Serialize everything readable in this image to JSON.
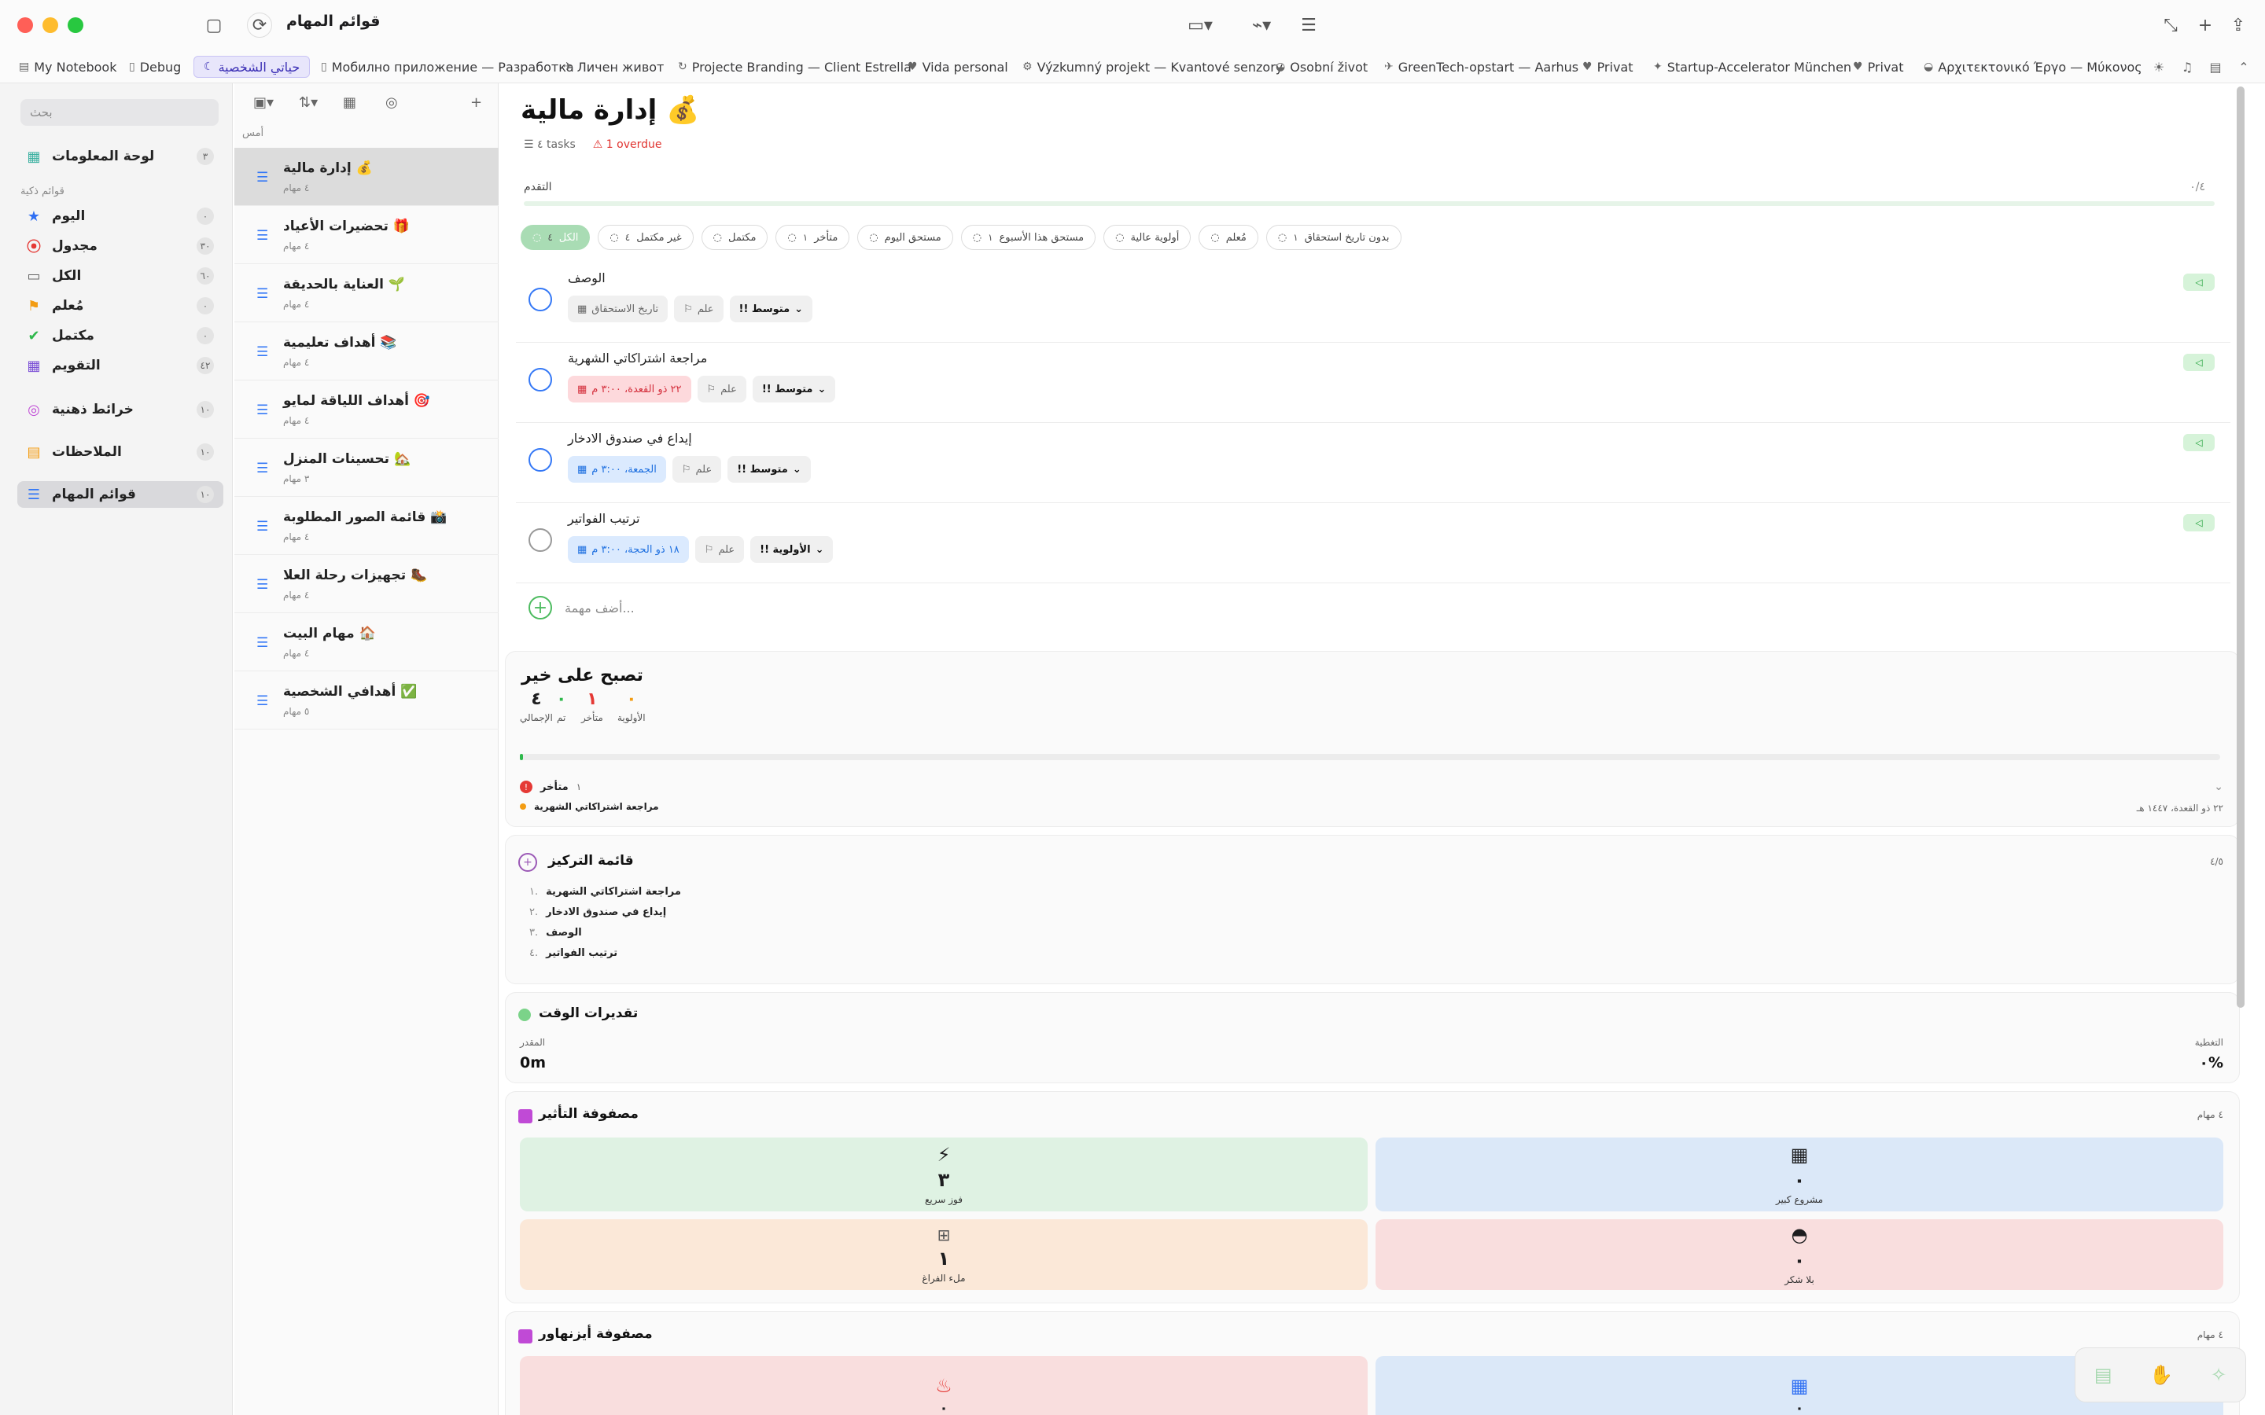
{
  "window": {
    "title": "قوائم المهام"
  },
  "tabs": [
    {
      "label": "My Notebook"
    },
    {
      "label": "Debug"
    },
    {
      "label": "حياتي الشخصية",
      "active": true
    },
    {
      "label": "Мобилно приложение — Разработка"
    },
    {
      "label": "Личен живот"
    },
    {
      "label": "Projecte Branding — Client Estrella"
    },
    {
      "label": "Vida personal"
    },
    {
      "label": "Výzkumný projekt — Kvantové senzory"
    },
    {
      "label": "Osobní život"
    },
    {
      "label": "GreenTech-opstart — Aarhus"
    },
    {
      "label": "Privat"
    },
    {
      "label": "Startup-Accelerator München"
    },
    {
      "label": "Privat"
    },
    {
      "label": "Αρχιτεκτονικό Έργο — Μύκονος"
    }
  ],
  "sidebar": {
    "search_placeholder": "بحث",
    "dashboard": {
      "label": "لوحة المعلومات",
      "count": "٣"
    },
    "smart_lists_title": "قوائم ذكية",
    "items": [
      {
        "label": "اليوم",
        "count": "٠",
        "icon": "star-icon",
        "color": "#2f6ff3"
      },
      {
        "label": "مجدول",
        "count": "٣٠",
        "icon": "calendar-circle-icon",
        "color": "#e53935"
      },
      {
        "label": "الكل",
        "count": "٦٠",
        "icon": "tray-icon",
        "color": "#666666"
      },
      {
        "label": "مُعلم",
        "count": "٠",
        "icon": "flag-icon",
        "color": "#f39c12"
      },
      {
        "label": "مكتمل",
        "count": "٠",
        "icon": "check-circle-icon",
        "color": "#2eb84b"
      },
      {
        "label": "التقويم",
        "count": "٤٢",
        "icon": "calendar-icon",
        "color": "#7b4fd6"
      }
    ],
    "mindmaps": {
      "label": "خرائط ذهنية",
      "count": "١٠"
    },
    "notes": {
      "label": "الملاحظات",
      "count": "١٠"
    },
    "tasklists": {
      "label": "قوائم المهام",
      "count": "١٠"
    }
  },
  "list_pane": {
    "date_label": "أمس",
    "items": [
      {
        "title": "إدارة مالية 💰",
        "sub": "٤ مهام"
      },
      {
        "title": "تحضيرات الأعياد 🎁",
        "sub": "٤ مهام"
      },
      {
        "title": "العناية بالحديقة 🌱",
        "sub": "٤ مهام"
      },
      {
        "title": "أهداف تعليمية 📚",
        "sub": "٤ مهام"
      },
      {
        "title": "أهداف اللياقة لمايو 🎯",
        "sub": "٤ مهام"
      },
      {
        "title": "تحسينات المنزل 🏡",
        "sub": "٣ مهام"
      },
      {
        "title": "قائمة الصور المطلوبة 📸",
        "sub": "٤ مهام"
      },
      {
        "title": "تجهيزات رحلة العلا 🥾",
        "sub": "٤ مهام"
      },
      {
        "title": "مهام البيت 🏠",
        "sub": "٤ مهام"
      },
      {
        "title": "أهدافي الشخصية ✅",
        "sub": "٥ مهام"
      }
    ]
  },
  "main": {
    "title": "إدارة مالية 💰",
    "tasks_count": "٤ tasks",
    "overdue": "1 overdue",
    "progress_label": "التقدم",
    "progress_count": "٠/٤",
    "progress_value": 0,
    "filters": [
      {
        "label": "الكل",
        "count": "٤",
        "on": true
      },
      {
        "label": "غير مكتمل",
        "count": "٤"
      },
      {
        "label": "مكتمل",
        "count": ""
      },
      {
        "label": "متأخر",
        "count": "١"
      },
      {
        "label": "مستحق اليوم",
        "count": ""
      },
      {
        "label": "مستحق هذا الأسبوع",
        "count": "١"
      },
      {
        "label": "أولوية عالية",
        "count": ""
      },
      {
        "label": "مُعلم",
        "count": ""
      },
      {
        "label": "بدون تاريخ استحقاق",
        "count": "١"
      }
    ],
    "tasks": [
      {
        "title": "الوصف",
        "date": "تاريخ الاستحقاق",
        "date_style": "plain",
        "flag": "علم",
        "priority": "!! متوسط",
        "tag": "◁"
      },
      {
        "title": "مراجعة اشتراكاتي الشهرية",
        "date": "٢٢ ذو القعدة، ٣:٠٠ م",
        "date_style": "red",
        "flag": "علم",
        "priority": "!! متوسط",
        "tag": "◁"
      },
      {
        "title": "إيداع في صندوق الادخار",
        "date": "الجمعة، ٣:٠٠ م",
        "date_style": "blue",
        "flag": "علم",
        "priority": "!! متوسط",
        "tag": "◁"
      },
      {
        "title": "ترتيب الفواتير",
        "date": "١٨ ذو الحجة، ٣:٠٠ م",
        "date_style": "blue",
        "flag": "علم",
        "priority": "!! الأولوية",
        "tag": "◁"
      }
    ],
    "add_task": "أضف مهمة..."
  },
  "summary": {
    "title": "تصبح على خير",
    "stats": [
      {
        "value": "٤",
        "label": "الإجمالي"
      },
      {
        "value": "٠",
        "label": "تم"
      },
      {
        "value": "١",
        "label": "متأخر"
      },
      {
        "value": "٠",
        "label": "الأولوية"
      }
    ],
    "overdue_label": "متأخر",
    "overdue_count": "١",
    "overdue_item": "مراجعة اشتراكاتي الشهرية",
    "overdue_date": "٢٢ ذو القعدة، ١٤٤٧ هـ"
  },
  "focus": {
    "title": "قائمة التركيز",
    "count": "٤/٥",
    "items": [
      {
        "n": "١.",
        "t": "مراجعة اشتراكاتي الشهرية"
      },
      {
        "n": "٢.",
        "t": "إيداع في صندوق الادخار"
      },
      {
        "n": "٣.",
        "t": "الوصف"
      },
      {
        "n": "٤.",
        "t": "ترتيب الفواتير"
      }
    ]
  },
  "time": {
    "title": "تقديرات الوقت",
    "est_label": "المقدر",
    "est_value": "0m",
    "cov_label": "التغطية",
    "cov_value": "٠%"
  },
  "impact": {
    "title": "مصفوفة التأثير",
    "count": "٤ مهام",
    "quads": [
      {
        "icon": "bolt-icon",
        "n": "٣",
        "label": "فوز سريع",
        "bg": "#dff2e3"
      },
      {
        "icon": "building-icon",
        "n": "٠",
        "label": "مشروع كبير",
        "bg": "#dbe8f8"
      },
      {
        "icon": "grid-icon",
        "n": "١",
        "label": "ملء الفراغ",
        "bg": "#fbe8d8"
      },
      {
        "icon": "turtle-icon",
        "n": "٠",
        "label": "بلا شكر",
        "bg": "#f9dede"
      }
    ]
  },
  "eisenhower": {
    "title": "مصفوفة أيزنهاور",
    "count": "٤ مهام",
    "quads": [
      {
        "icon": "fire-icon",
        "n": "٠"
      },
      {
        "icon": "calendar-icon",
        "n": "٠"
      }
    ]
  }
}
